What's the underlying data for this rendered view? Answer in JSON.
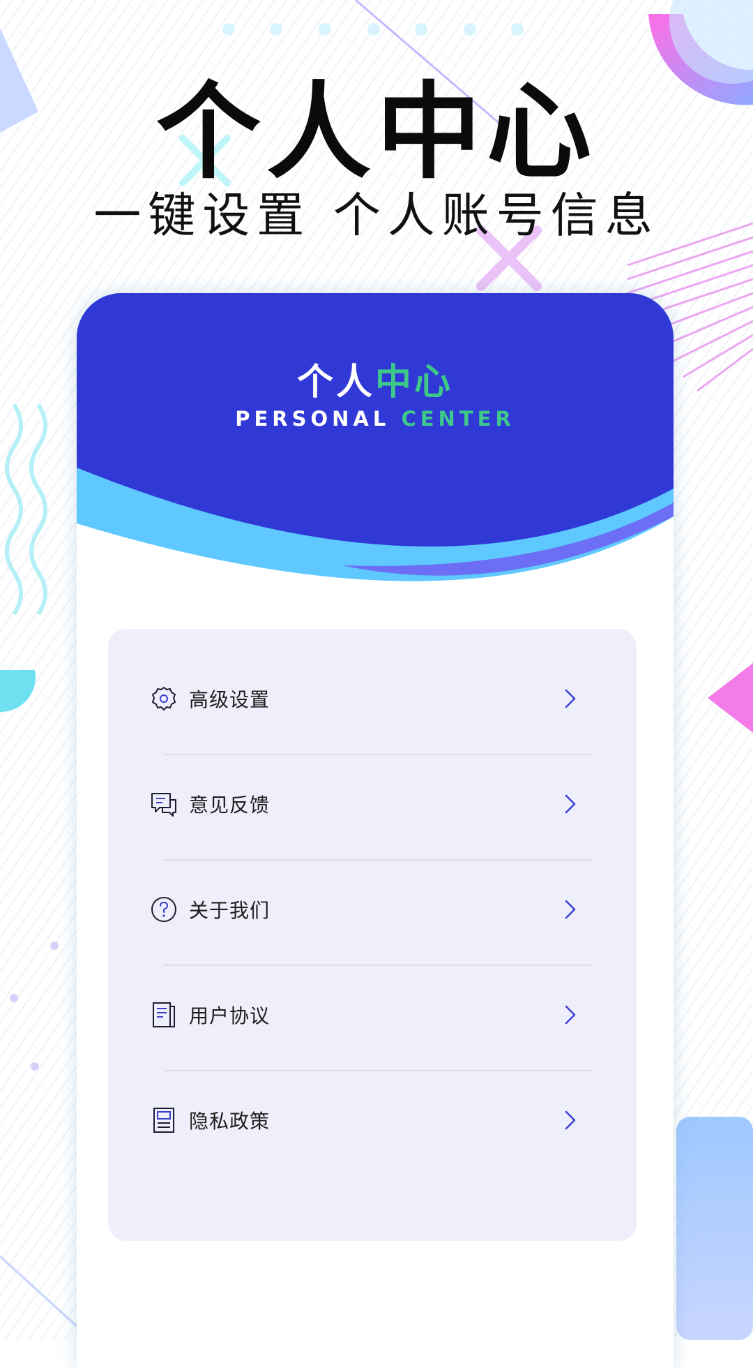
{
  "promo": {
    "title": "个人中心",
    "subtitle": "一键设置  个人账号信息"
  },
  "brand": {
    "cn_white": "个人",
    "cn_accent": "中心",
    "en_white": "PERSONAL",
    "en_accent": "CENTER"
  },
  "colors": {
    "header_blue": "#3038d6",
    "accent_green": "#3ec98a",
    "wave_cyan": "#5ec8ff",
    "wave_violet": "#6c6ef5",
    "card_bg": "#efeffb",
    "arrow_blue": "#3a3fd0"
  },
  "menu": {
    "items": [
      {
        "label": "高级设置",
        "icon": "gear-icon"
      },
      {
        "label": "意见反馈",
        "icon": "chat-bubbles-icon"
      },
      {
        "label": "关于我们",
        "icon": "question-circle-icon"
      },
      {
        "label": "用户协议",
        "icon": "agreement-document-icon"
      },
      {
        "label": "隐私政策",
        "icon": "privacy-book-icon"
      }
    ],
    "arrow_icon": "chevron-right-icon"
  }
}
